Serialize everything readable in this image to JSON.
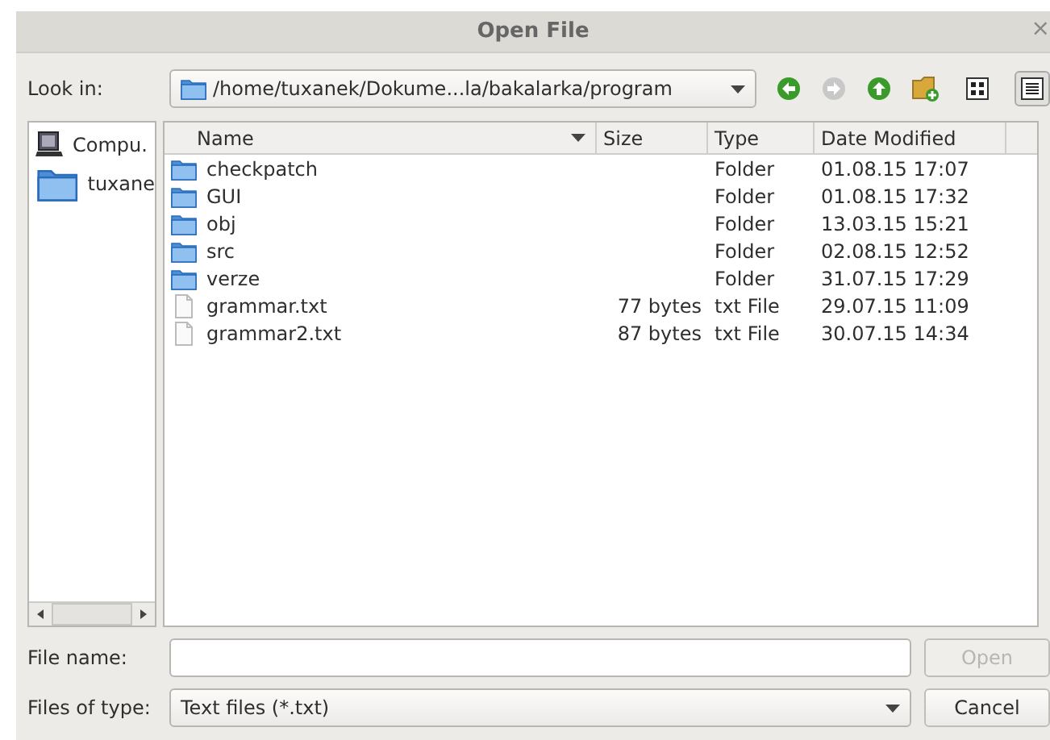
{
  "window": {
    "title": "Open File",
    "close": "×"
  },
  "look_in": {
    "label": "Look in:",
    "path": "/home/tuxanek/Dokume...la/bakalarka/program"
  },
  "toolbar": [
    {
      "kind": "back",
      "disabled": false
    },
    {
      "kind": "forward",
      "disabled": true
    },
    {
      "kind": "up",
      "disabled": false
    },
    {
      "kind": "new-folder",
      "disabled": false
    },
    {
      "kind": "icon-view",
      "selected": false
    },
    {
      "kind": "detail-view",
      "selected": true
    }
  ],
  "sidebar": {
    "items": [
      {
        "kind": "computer",
        "label": "Compu."
      },
      {
        "kind": "folder",
        "label": "tuxane"
      }
    ]
  },
  "table": {
    "columns": [
      "Name",
      "Size",
      "Type",
      "Date Modified"
    ],
    "rows": [
      {
        "kind": "folder",
        "name": "checkpatch",
        "type": "Folder",
        "date": "01.08.15 17:07"
      },
      {
        "kind": "folder",
        "name": "GUI",
        "type": "Folder",
        "date": "01.08.15 17:32"
      },
      {
        "kind": "folder",
        "name": "obj",
        "type": "Folder",
        "date": "13.03.15 15:21"
      },
      {
        "kind": "folder",
        "name": "src",
        "type": "Folder",
        "date": "02.08.15 12:52"
      },
      {
        "kind": "folder",
        "name": "verze",
        "type": "Folder",
        "date": "31.07.15 17:29"
      },
      {
        "kind": "file",
        "name": "grammar.txt",
        "size": "77 bytes",
        "type": "txt File",
        "date": "29.07.15 11:09"
      },
      {
        "kind": "file",
        "name": "grammar2.txt",
        "size": "87 bytes",
        "type": "txt File",
        "date": "30.07.15 14:34"
      }
    ]
  },
  "file_name": {
    "label": "File name:"
  },
  "files_of_type": {
    "label": "Files of type:",
    "value": "Text files (*.txt)"
  },
  "buttons": [
    {
      "label": "Open",
      "disabled": true
    },
    {
      "label": "Cancel",
      "disabled": false
    }
  ]
}
